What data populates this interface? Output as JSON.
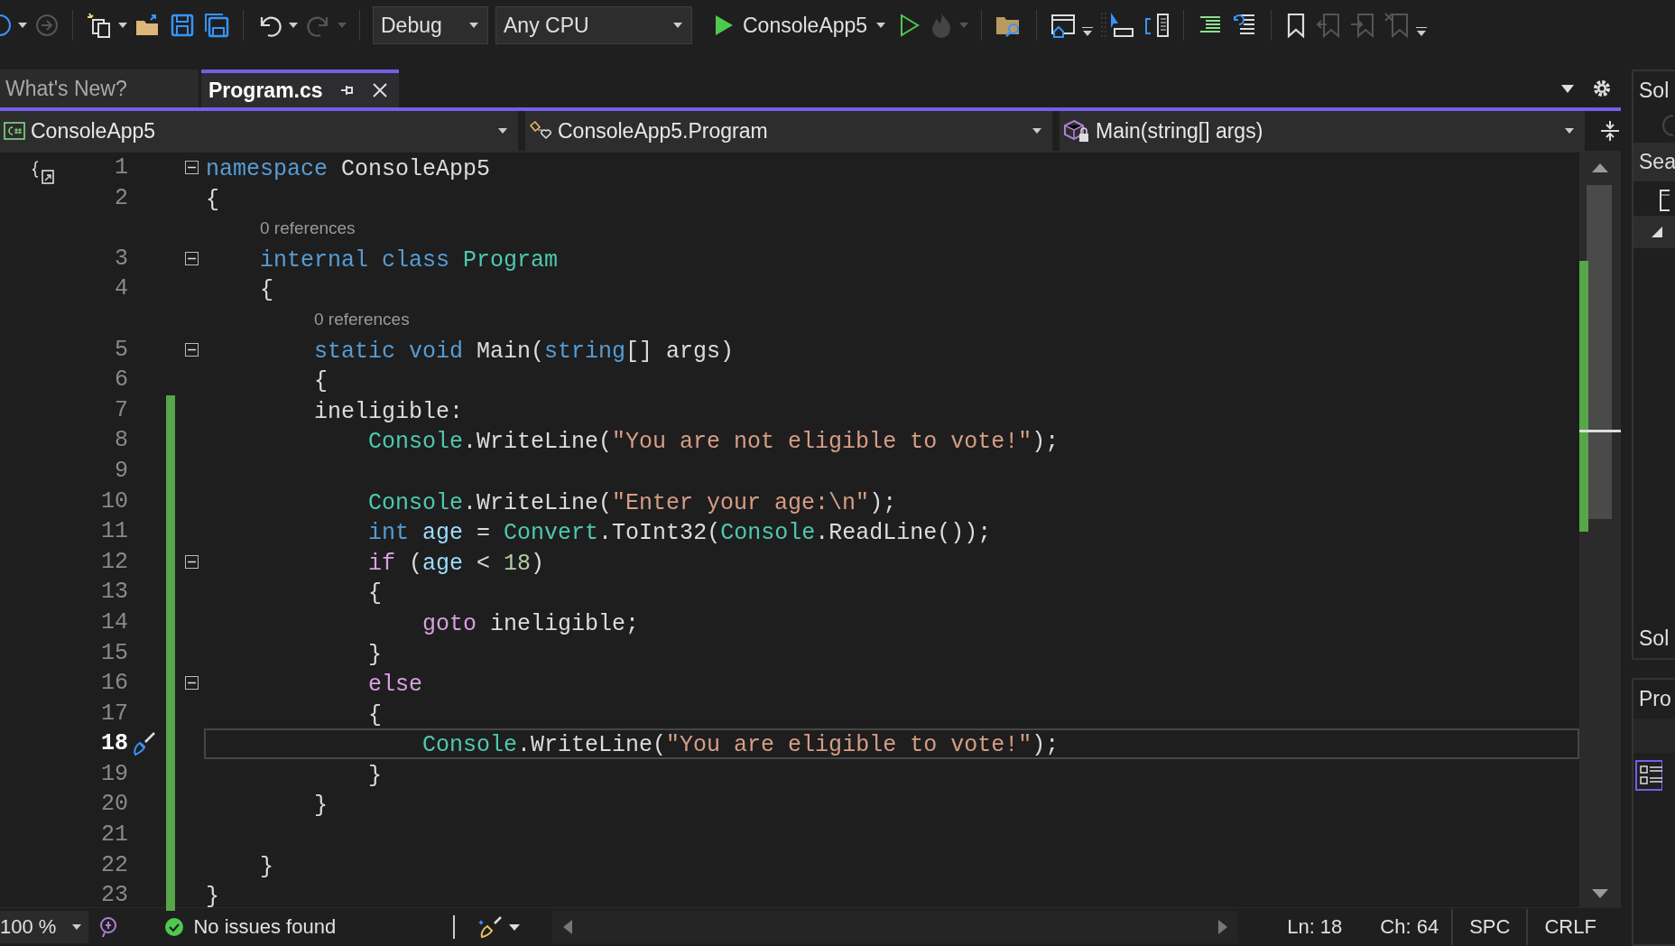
{
  "toolbar": {
    "configuration": "Debug",
    "platform": "Any CPU",
    "start_target": "ConsoleApp5"
  },
  "tabs": [
    {
      "label": "What's New?",
      "selected": false
    },
    {
      "label": "Program.cs",
      "selected": true
    }
  ],
  "navigation": {
    "project": "ConsoleApp5",
    "type": "ConsoleApp5.Program",
    "member": "Main(string[] args)"
  },
  "editor": {
    "lines": [
      {
        "number": "1",
        "fold": true,
        "changed": false,
        "current": false,
        "tokens": [
          {
            "text": "namespace",
            "kind": "keyword"
          },
          {
            "text": " ConsoleApp5",
            "kind": "plain"
          }
        ]
      },
      {
        "number": "2",
        "fold": false,
        "changed": false,
        "current": false,
        "tokens": [
          {
            "text": "{",
            "kind": "plain"
          }
        ]
      },
      {
        "number": "3",
        "fold": true,
        "changed": false,
        "current": false,
        "references": "0 references",
        "tokens": [
          {
            "text": "    internal class",
            "kind": "keyword"
          },
          {
            "text": " Program",
            "kind": "type"
          }
        ]
      },
      {
        "number": "4",
        "fold": false,
        "changed": false,
        "current": false,
        "tokens": [
          {
            "text": "    {",
            "kind": "plain"
          }
        ]
      },
      {
        "number": "5",
        "fold": true,
        "changed": false,
        "current": false,
        "references": "0 references",
        "tokens": [
          {
            "text": "        static void",
            "kind": "keyword"
          },
          {
            "text": " Main(",
            "kind": "plain"
          },
          {
            "text": "string",
            "kind": "keyword"
          },
          {
            "text": "[] args)",
            "kind": "plain"
          }
        ]
      },
      {
        "number": "6",
        "fold": false,
        "changed": false,
        "current": false,
        "tokens": [
          {
            "text": "        {",
            "kind": "plain"
          }
        ]
      },
      {
        "number": "7",
        "fold": false,
        "changed": true,
        "current": false,
        "tokens": [
          {
            "text": "        ineligible:",
            "kind": "plain"
          }
        ]
      },
      {
        "number": "8",
        "fold": false,
        "changed": true,
        "current": false,
        "tokens": [
          {
            "text": "            Console",
            "kind": "type"
          },
          {
            "text": ".WriteLine(",
            "kind": "plain"
          },
          {
            "text": "\"You are not eligible to vote!\"",
            "kind": "string"
          },
          {
            "text": ");",
            "kind": "plain"
          }
        ]
      },
      {
        "number": "9",
        "fold": false,
        "changed": true,
        "current": false
      },
      {
        "number": "10",
        "fold": false,
        "changed": true,
        "current": false,
        "tokens": [
          {
            "text": "            Console",
            "kind": "type"
          },
          {
            "text": ".WriteLine(",
            "kind": "plain"
          },
          {
            "text": "\"Enter your age:\\n\"",
            "kind": "string"
          },
          {
            "text": ");",
            "kind": "plain"
          }
        ]
      },
      {
        "number": "11",
        "fold": false,
        "changed": true,
        "current": false,
        "tokens": [
          {
            "text": "            int",
            "kind": "keyword"
          },
          {
            "text": " age",
            "kind": "variable"
          },
          {
            "text": " = ",
            "kind": "plain"
          },
          {
            "text": "Convert",
            "kind": "type"
          },
          {
            "text": ".ToInt32(",
            "kind": "plain"
          },
          {
            "text": "Console",
            "kind": "type"
          },
          {
            "text": ".ReadLine());",
            "kind": "plain"
          }
        ]
      },
      {
        "number": "12",
        "fold": true,
        "changed": true,
        "current": false,
        "tokens": [
          {
            "text": "            if",
            "kind": "control"
          },
          {
            "text": " (",
            "kind": "plain"
          },
          {
            "text": "age",
            "kind": "variable"
          },
          {
            "text": " < ",
            "kind": "plain"
          },
          {
            "text": "18",
            "kind": "number"
          },
          {
            "text": ")",
            "kind": "plain"
          }
        ]
      },
      {
        "number": "13",
        "fold": false,
        "changed": true,
        "current": false,
        "tokens": [
          {
            "text": "            {",
            "kind": "plain"
          }
        ]
      },
      {
        "number": "14",
        "fold": false,
        "changed": true,
        "current": false,
        "tokens": [
          {
            "text": "                goto",
            "kind": "control"
          },
          {
            "text": " ineligible;",
            "kind": "plain"
          }
        ]
      },
      {
        "number": "15",
        "fold": false,
        "changed": true,
        "current": false,
        "tokens": [
          {
            "text": "            }",
            "kind": "plain"
          }
        ]
      },
      {
        "number": "16",
        "fold": true,
        "changed": true,
        "current": false,
        "tokens": [
          {
            "text": "            else",
            "kind": "control"
          }
        ]
      },
      {
        "number": "17",
        "fold": false,
        "changed": true,
        "current": false,
        "tokens": [
          {
            "text": "            {",
            "kind": "plain"
          }
        ]
      },
      {
        "number": "18",
        "fold": false,
        "changed": true,
        "current": true,
        "tokens": [
          {
            "text": "                Console",
            "kind": "type"
          },
          {
            "text": ".WriteLine(",
            "kind": "plain"
          },
          {
            "text": "\"You are eligible to vote!\"",
            "kind": "string"
          },
          {
            "text": ");",
            "kind": "plain"
          }
        ]
      },
      {
        "number": "19",
        "fold": false,
        "changed": true,
        "current": false,
        "tokens": [
          {
            "text": "            }",
            "kind": "plain"
          }
        ]
      },
      {
        "number": "20",
        "fold": false,
        "changed": true,
        "current": false,
        "tokens": [
          {
            "text": "        }",
            "kind": "plain"
          }
        ]
      },
      {
        "number": "21",
        "fold": false,
        "changed": true,
        "current": false
      },
      {
        "number": "22",
        "fold": false,
        "changed": true,
        "current": false,
        "tokens": [
          {
            "text": "    }",
            "kind": "plain"
          }
        ]
      },
      {
        "number": "23",
        "fold": false,
        "changed": true,
        "current": false,
        "tokens": [
          {
            "text": "}",
            "kind": "plain"
          }
        ]
      }
    ]
  },
  "status_bar": {
    "zoom": "100 %",
    "issues": "No issues found",
    "line": "Ln: 18",
    "column": "Ch: 64",
    "whitespace": "SPC",
    "line_ending": "CRLF"
  },
  "side_panel": {
    "header": "Sol",
    "search": "Sea",
    "footer": "Sol",
    "second_header": "Pro"
  }
}
